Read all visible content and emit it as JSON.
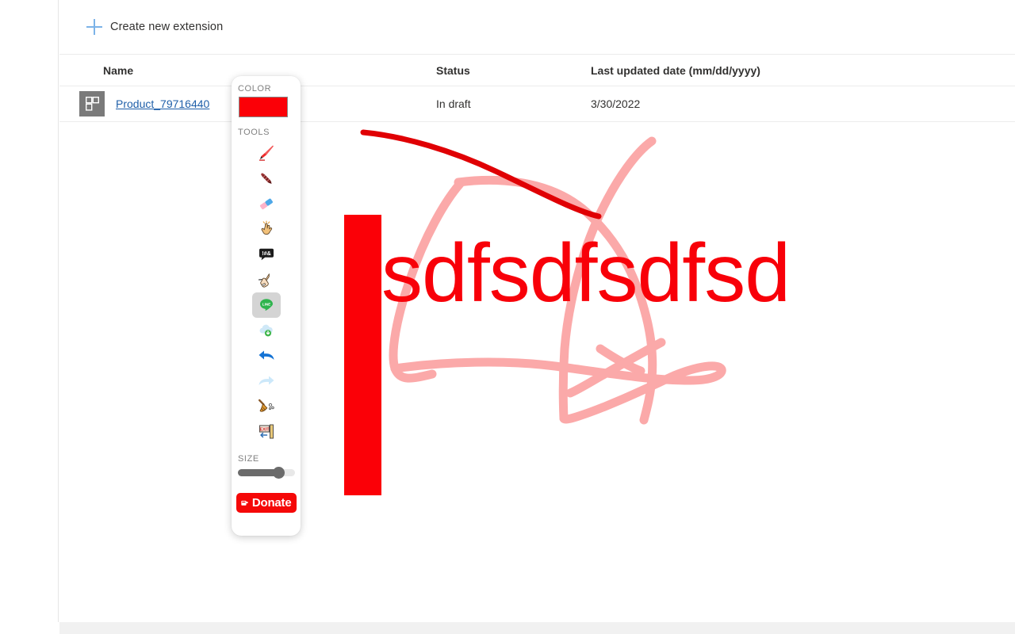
{
  "command_bar": {
    "create_label": "Create new extension",
    "plus_icon": "plus-icon"
  },
  "table": {
    "columns": {
      "name": "Name",
      "status": "Status",
      "date": "Last updated date (mm/dd/yyyy)"
    },
    "rows": [
      {
        "thumbnail_icon": "extension-thumbnail-icon",
        "name": "Product_79716440",
        "status": "In draft",
        "date": "3/30/2022"
      }
    ]
  },
  "annotation": {
    "text": "sdfsdfsdfsd",
    "text_color": "#f80009",
    "rect_color": "#fb0007",
    "stroke_color_dark": "#e00004",
    "stroke_color_light": "#fba9a9"
  },
  "toolbar": {
    "color_label": "COLOR",
    "current_color": "#fb0007",
    "tools_label": "TOOLS",
    "tools": [
      {
        "name": "marker-tool",
        "icon": "marker-icon",
        "selected": false,
        "disabled": false
      },
      {
        "name": "pen-tool",
        "icon": "pen-icon",
        "selected": false,
        "disabled": false
      },
      {
        "name": "eraser-tool",
        "icon": "eraser-icon",
        "selected": false,
        "disabled": false
      },
      {
        "name": "cursor-tool",
        "icon": "pointing-hand-icon",
        "selected": false,
        "disabled": false
      },
      {
        "name": "text-tool",
        "icon": "speech-bubble-icon",
        "selected": false,
        "disabled": false
      },
      {
        "name": "write-tool",
        "icon": "writing-hand-icon",
        "selected": false,
        "disabled": false
      },
      {
        "name": "line-share-tool",
        "icon": "line-app-icon",
        "selected": true,
        "disabled": false
      },
      {
        "name": "save-cloud-tool",
        "icon": "cloud-download-icon",
        "selected": false,
        "disabled": false
      },
      {
        "name": "undo-tool",
        "icon": "undo-arrow-icon",
        "selected": false,
        "disabled": false
      },
      {
        "name": "redo-tool",
        "icon": "redo-arrow-icon",
        "selected": false,
        "disabled": true
      },
      {
        "name": "clear-tool",
        "icon": "broom-icon",
        "selected": false,
        "disabled": false
      },
      {
        "name": "exit-tool",
        "icon": "exit-sign-icon",
        "selected": false,
        "disabled": false
      }
    ],
    "size_label": "SIZE",
    "size_percent": 70,
    "donate_label": "Donate",
    "donate_icon": "coffee-cup-icon",
    "donate_color": "#f50808"
  }
}
